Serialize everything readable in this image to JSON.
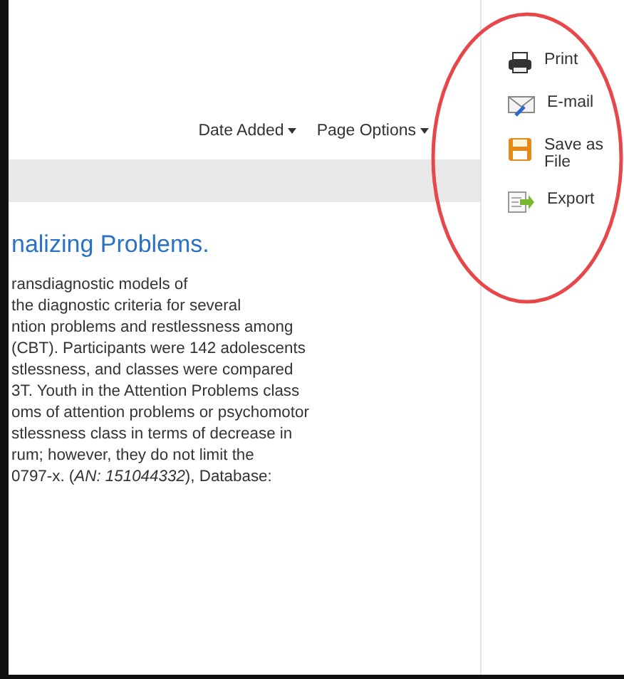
{
  "toolbar": {
    "menus": [
      {
        "label": "Date Added"
      },
      {
        "label": "Page Options"
      }
    ]
  },
  "article": {
    "title": "nalizing Problems.",
    "lines": [
      "ransdiagnostic models of",
      "the diagnostic criteria for several",
      "ntion problems and restlessness among",
      "(CBT). Participants were 142 adolescents",
      "stlessness, and classes were compared",
      "3T. Youth in the Attention Problems class",
      "oms of attention problems or psychomotor",
      "stlessness class in terms of decrease in",
      "rum; however, they do not limit the",
      "0797-x. (*AN: 151044332*), Database:"
    ]
  },
  "tools": [
    {
      "kind": "print",
      "label": "Print"
    },
    {
      "kind": "email",
      "label": "E-mail"
    },
    {
      "kind": "save",
      "label": "Save as File"
    },
    {
      "kind": "export",
      "label": "Export"
    }
  ]
}
